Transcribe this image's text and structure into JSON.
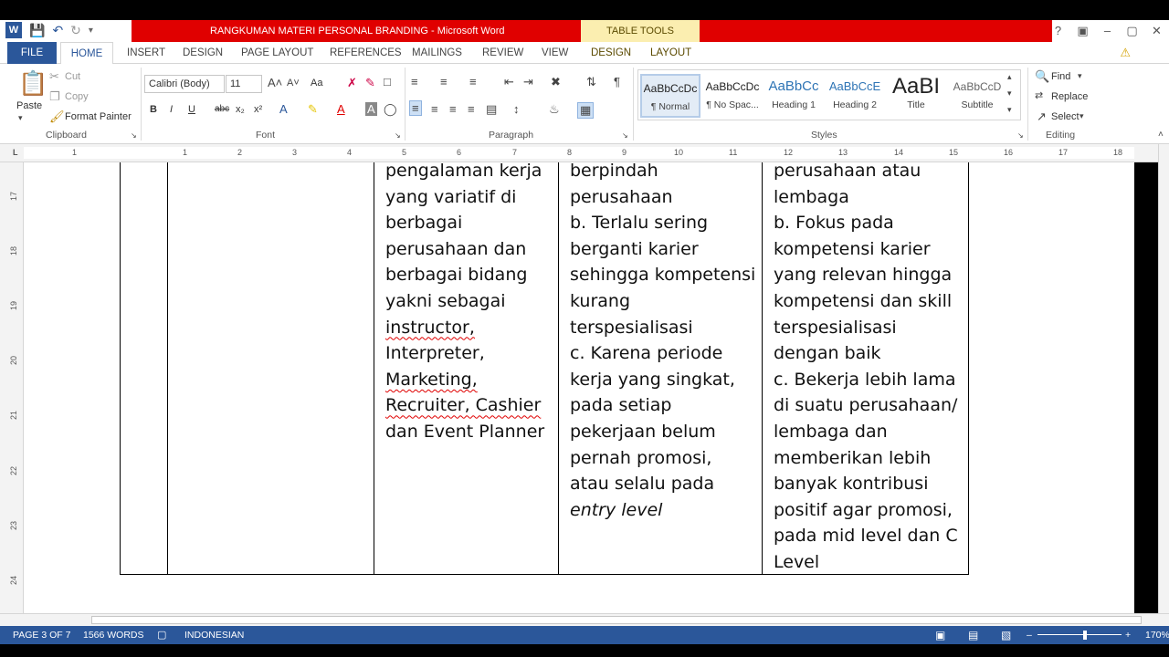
{
  "window": {
    "title": "RANGKUMAN MATERI PERSONAL BRANDING - Microsoft Word",
    "contextual_tab": "TABLE TOOLS",
    "controls": [
      "?",
      "▣",
      "–",
      "▢",
      "✕"
    ]
  },
  "tabs": [
    {
      "label": "FILE"
    },
    {
      "label": "HOME"
    },
    {
      "label": "INSERT"
    },
    {
      "label": "DESIGN"
    },
    {
      "label": "PAGE LAYOUT"
    },
    {
      "label": "REFERENCES"
    },
    {
      "label": "MAILINGS"
    },
    {
      "label": "REVIEW"
    },
    {
      "label": "VIEW"
    },
    {
      "label": "DESIGN"
    },
    {
      "label": "LAYOUT"
    }
  ],
  "clipboard": {
    "paste": "Paste",
    "cut": "Cut",
    "copy": "Copy",
    "format_painter": "Format Painter",
    "label": "Clipboard"
  },
  "font": {
    "name": "Calibri (Body)",
    "size": "11",
    "label": "Font",
    "change_case": "Aa",
    "bold": "B",
    "italic": "I",
    "underline": "U",
    "strike": "abc",
    "sub": "x₂",
    "sup": "x²"
  },
  "paragraph": {
    "label": "Paragraph"
  },
  "styles": {
    "label": "Styles",
    "items": [
      {
        "sample": "AaBbCcDc",
        "name": "¶ Normal"
      },
      {
        "sample": "AaBbCcDc",
        "name": "¶ No Spac..."
      },
      {
        "sample": "AaBbCc",
        "name": "Heading 1"
      },
      {
        "sample": "AaBbCcE",
        "name": "Heading 2"
      },
      {
        "sample": "AaBI",
        "name": "Title"
      },
      {
        "sample": "AaBbCcD",
        "name": "Subtitle"
      }
    ]
  },
  "editing": {
    "label": "Editing",
    "find": "Find",
    "replace": "Replace",
    "select": "Select"
  },
  "ruler": {
    "h_ticks": [
      "1",
      "1",
      "2",
      "3",
      "4",
      "5",
      "6",
      "7",
      "8",
      "9",
      "10",
      "11",
      "12",
      "13",
      "14",
      "15",
      "16",
      "17",
      "18"
    ],
    "v_ticks": [
      "17",
      "18",
      "19",
      "20",
      "21",
      "22",
      "23",
      "24"
    ]
  },
  "document": {
    "col3": [
      "pengalaman kerja",
      "yang variatif di",
      "berbagai",
      "perusahaan dan",
      "berbagai bidang",
      "yakni sebagai",
      "instructor,",
      "Interpreter,",
      "Marketing,",
      "Recruiter, Cashier",
      "dan Event Planner"
    ],
    "col4": [
      "berpindah",
      "perusahaan",
      "b. Terlalu sering",
      "berganti karier",
      "sehingga kompetensi",
      "kurang",
      "terspesialisasi",
      "c. Karena periode",
      "kerja yang singkat,",
      "pada setiap",
      "pekerjaan belum",
      "pernah promosi,",
      "atau selalu pada",
      "entry level"
    ],
    "col5": [
      "perusahaan atau",
      "lembaga",
      "b. Fokus pada",
      "kompetensi karier",
      "yang relevan hingga",
      "kompetensi dan skill",
      "terspesialisasi",
      "dengan baik",
      "c.  Bekerja lebih lama",
      "di suatu perusahaan/",
      "lembaga dan",
      "memberikan lebih",
      "banyak kontribusi",
      "positif agar promosi,",
      "pada mid level dan C",
      "Level"
    ]
  },
  "status": {
    "page": "PAGE 3 OF 7",
    "words": "1566 WORDS",
    "language": "INDONESIAN",
    "zoom": "170%"
  }
}
